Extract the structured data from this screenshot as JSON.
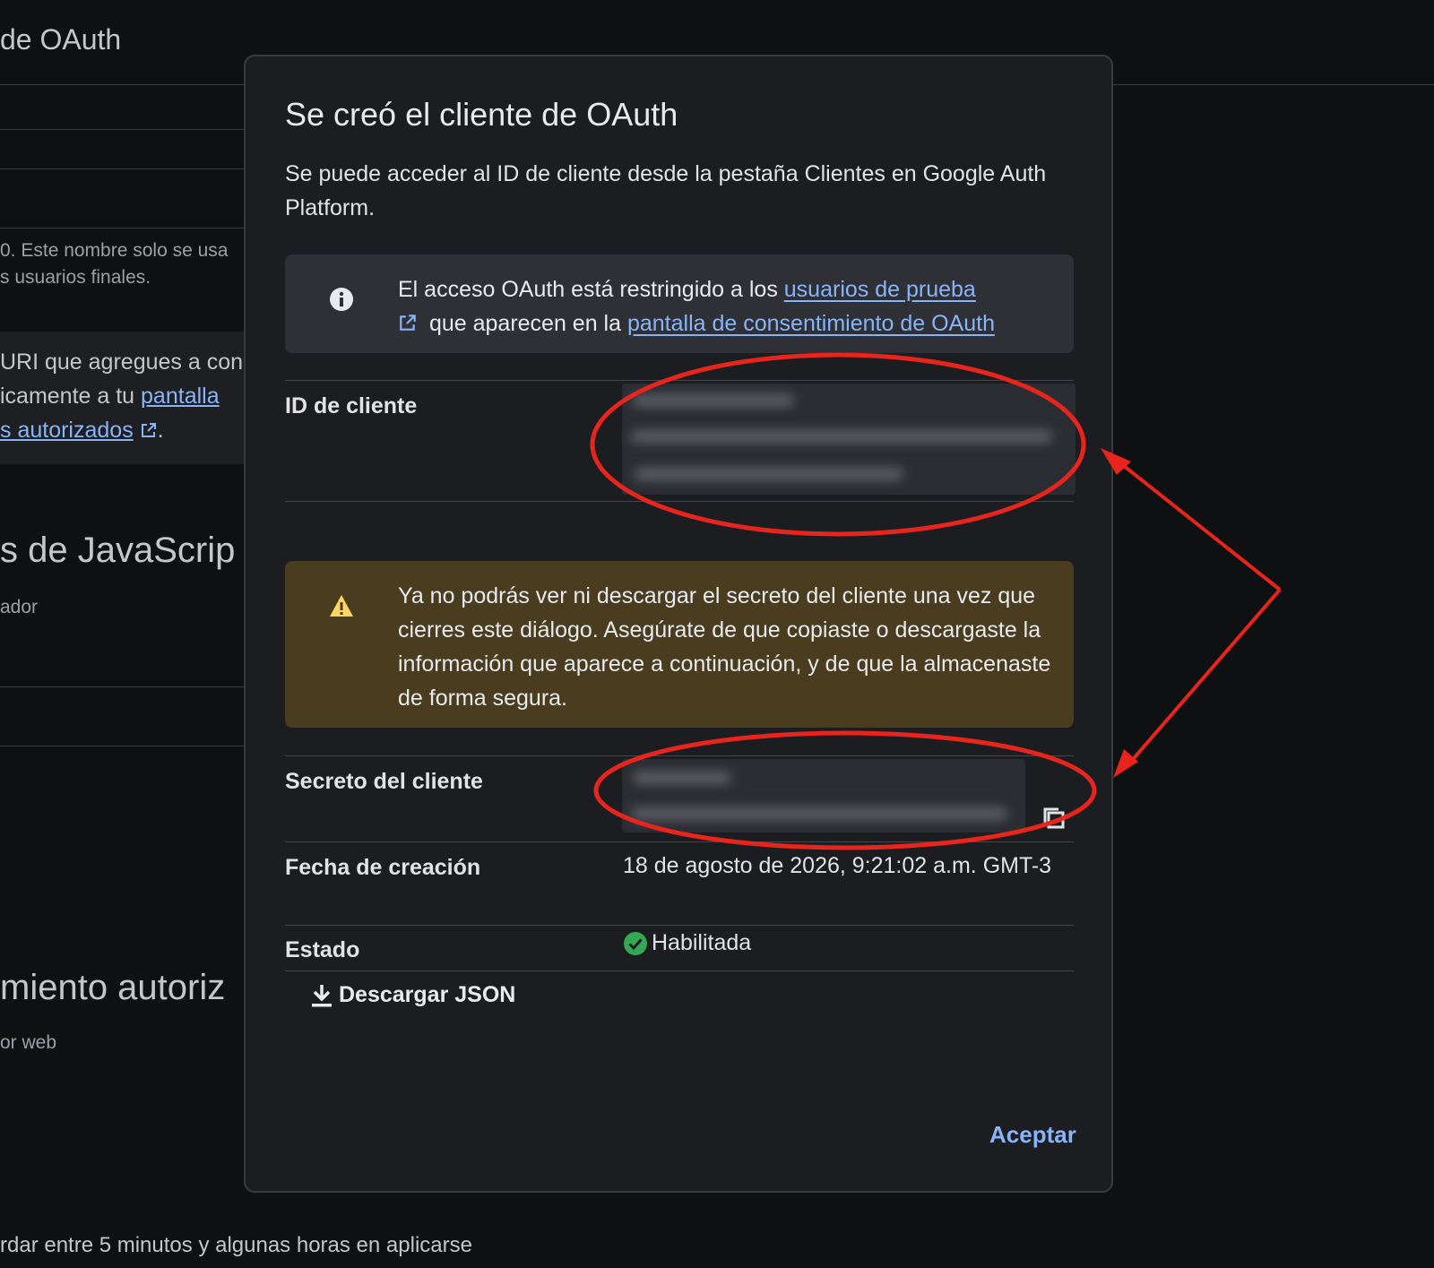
{
  "background": {
    "page_title": "de OAuth",
    "name_hint_line1": "0. Este nombre solo se usa",
    "name_hint_line2": "s usuarios finales.",
    "info_line1": "URI que agregues a con",
    "info_line2_prefix": "icamente a tu ",
    "info_line2_link": "pantalla",
    "info_line3_link": "s autorizados",
    "info_line3_suffix": ".",
    "js_heading": "s de JavaScrip",
    "js_sub": "ador",
    "redirect_heading": "miento autoriz",
    "redirect_sub": "or web",
    "footer_note": "rdar entre 5 minutos y algunas horas en aplicarse"
  },
  "dialog": {
    "title": "Se creó el cliente de OAuth",
    "description": "Se puede acceder al ID de cliente desde la pestaña Clientes en Google Auth Platform.",
    "info_banner": {
      "icon": "info-icon",
      "text_prefix": "El acceso OAuth está restringido a los ",
      "link1": "usuarios de prueba",
      "text_middle": " que aparecen en la ",
      "link2": "pantalla de consentimiento de OAuth"
    },
    "client_id_label": "ID de cliente",
    "warning_banner": {
      "icon": "warning-icon",
      "text": "Ya no podrás ver ni descargar el secreto del cliente una vez que cierres este diálogo. Asegúrate de que copiaste o descargaste la información que aparece a continuación, y de que la almacenaste de forma segura."
    },
    "client_secret_label": "Secreto del cliente",
    "created_label": "Fecha de creación",
    "created_value": "18 de agosto de 2026, 9:21:02 a.m. GMT-3",
    "status_label": "Estado",
    "status_value": "Habilitada",
    "download_label": "Descargar JSON",
    "accept_label": "Aceptar"
  },
  "colors": {
    "accent": "#8ab4f8",
    "status_ok": "#34a853",
    "warning_bg": "#4a3d1f",
    "warning_icon": "#fdd663",
    "annotation_red": "#e8251c"
  }
}
